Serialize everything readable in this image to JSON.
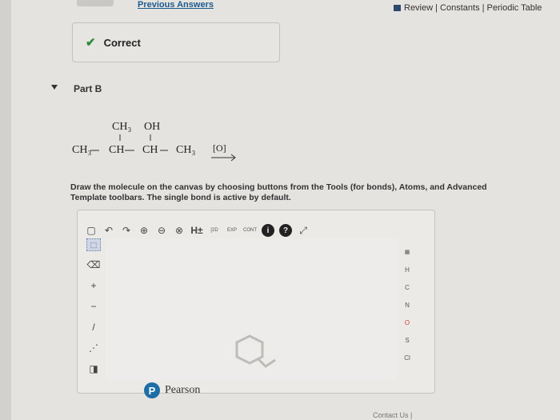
{
  "header": {
    "previous_answers": "Previous Answers",
    "nav": "Review | Constants | Periodic Table"
  },
  "feedback": {
    "correct_label": "Correct"
  },
  "part": {
    "title": "Part B"
  },
  "reaction": {
    "substituent_1": "CH₃",
    "substituent_2": "OH",
    "chain_ch3_left": "CH₃",
    "chain_ch_1": "CH",
    "chain_ch_2": "CH",
    "chain_ch3_right": "CH₃",
    "reagent": "[O]"
  },
  "instructions": "Draw the molecule on the canvas by choosing buttons from the Tools (for bonds), Atoms, and Advanced Template toolbars. The single bond is active by default.",
  "toolbar": {
    "hydrogen_label": "H±",
    "charge_label": "[2D",
    "exp_label": "EXP",
    "cont_label": "CONT"
  },
  "atoms": [
    "H",
    "C",
    "N",
    "O",
    "S",
    "Cl"
  ],
  "footer": {
    "contact": "Contact Us |"
  },
  "brand": {
    "name": "Pearson",
    "logo_letter": "P"
  },
  "colors": {
    "check": "#2e8b3a",
    "brand": "#1d6ea6"
  }
}
